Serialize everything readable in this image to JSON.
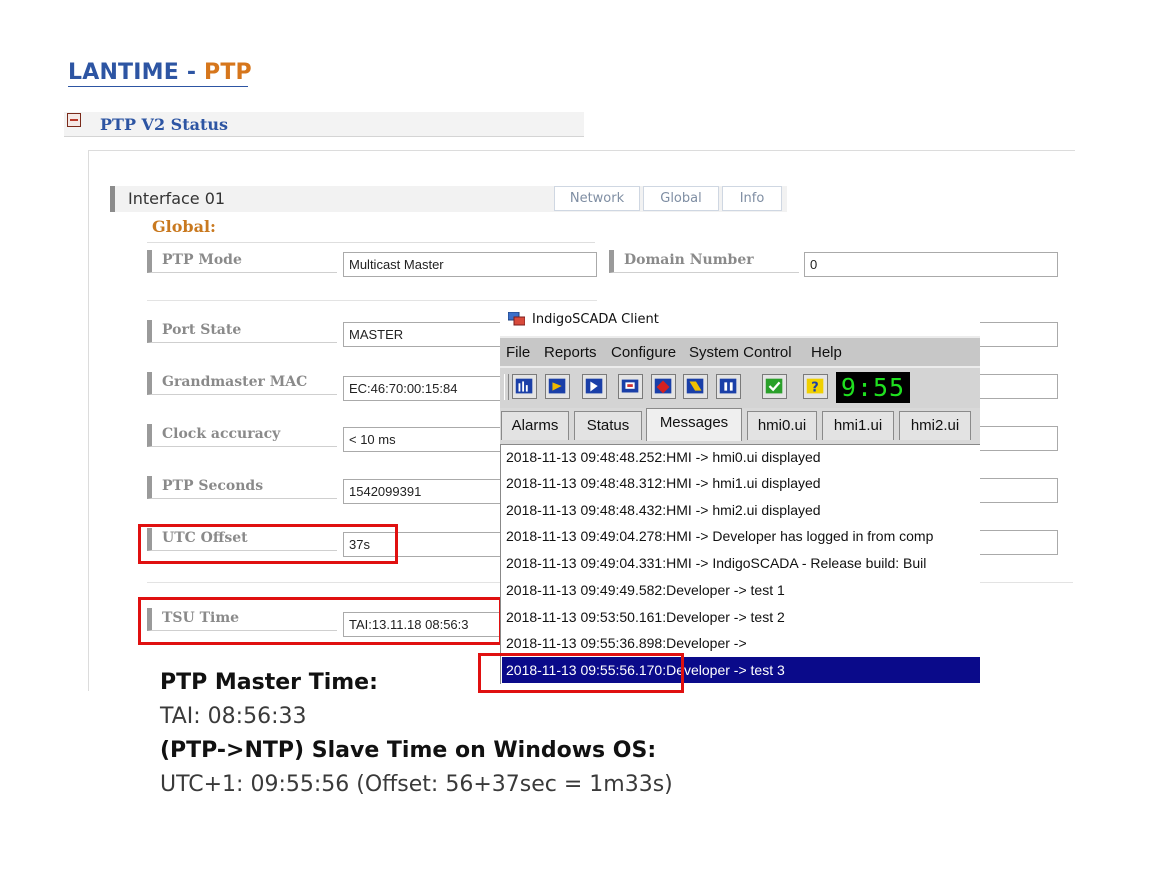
{
  "slide_title": {
    "prefix": "LANTIME - ",
    "highlight": "PTP"
  },
  "section": {
    "title": "PTP V2 Status"
  },
  "interface": {
    "label": "Interface 01",
    "tabs": [
      "Network",
      "Global",
      "Info"
    ],
    "group_label": "Global:"
  },
  "fields": {
    "ptp_mode": {
      "label": "PTP Mode",
      "value": "Multicast Master"
    },
    "domain_number": {
      "label": "Domain Number",
      "value": "0"
    },
    "port_state": {
      "label": "Port State",
      "value": "MASTER"
    },
    "grandmaster_mac": {
      "label": "Grandmaster MAC",
      "value": "EC:46:70:00:15:84"
    },
    "clock_accuracy": {
      "label": "Clock accuracy",
      "value": "< 10 ms"
    },
    "ptp_seconds": {
      "label": "PTP Seconds",
      "value": "1542099391"
    },
    "utc_offset": {
      "label": "UTC Offset",
      "value": "37s"
    },
    "tsu_time": {
      "label": "TSU Time",
      "value": "TAI:13.11.18 08:56:3"
    }
  },
  "client": {
    "title": "IndigoSCADA Client",
    "menu": [
      "File",
      "Reports",
      "Configure",
      "System Control",
      "Help"
    ],
    "toolbar_icons": [
      "report-icon",
      "import-icon",
      "wizard-icon",
      "export-icon",
      "alarm-ack-icon",
      "tag-icon",
      "pause-icon",
      "check-icon",
      "help-icon"
    ],
    "clock": "9:55",
    "tabs": [
      "Alarms",
      "Status",
      "Messages",
      "hmi0.ui",
      "hmi1.ui",
      "hmi2.ui"
    ],
    "active_tab": "Messages",
    "messages": [
      "2018-11-13 09:48:48.252:HMI -> hmi0.ui displayed",
      "2018-11-13 09:48:48.312:HMI -> hmi1.ui displayed",
      "2018-11-13 09:48:48.432:HMI -> hmi2.ui displayed",
      "2018-11-13 09:49:04.278:HMI -> Developer has logged in from comp",
      "2018-11-13 09:49:04.331:HMI -> IndigoSCADA - Release build: Buil",
      "2018-11-13 09:49:49.582:Developer -> test 1",
      "2018-11-13 09:53:50.161:Developer -> test 2",
      "2018-11-13 09:55:36.898:Developer ->",
      "2018-11-13 09:55:56.170:Developer -> test 3"
    ]
  },
  "caption": {
    "line1": "PTP Master Time:",
    "line2": "TAI: 08:56:33",
    "line3": "(PTP->NTP) Slave Time on Windows OS:",
    "line4": "UTC+1: 09:55:56 (Offset: 56+37sec = 1m33s)"
  },
  "colors": {
    "title_blue": "#2d55a3",
    "title_orange": "#d6761c",
    "highlight_red": "#e01010",
    "selection_navy": "#0a0a8a",
    "clock_green": "#1fe01f"
  }
}
